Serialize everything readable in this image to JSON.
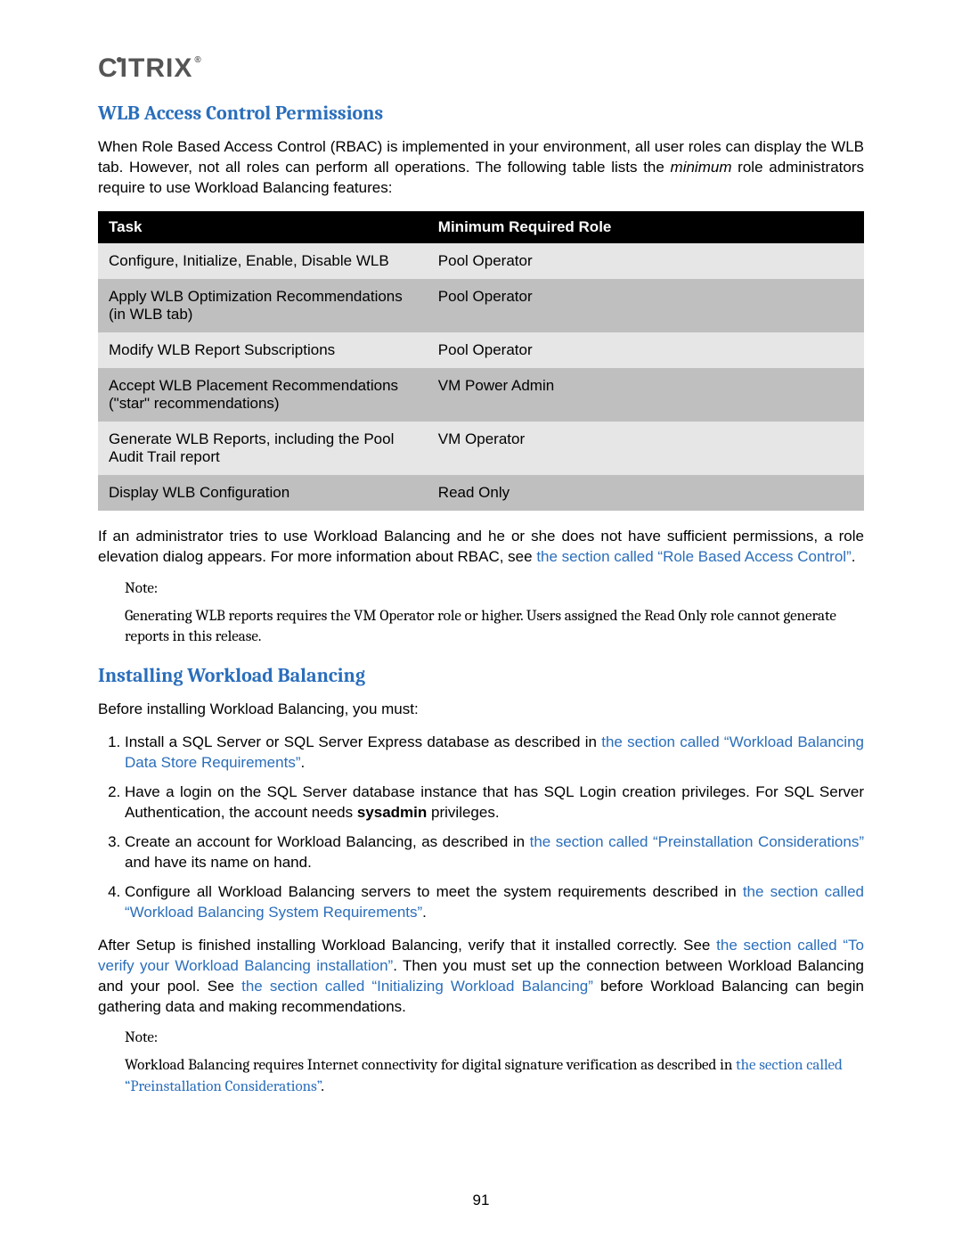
{
  "logo": "CITRIX",
  "sections": {
    "wlb_heading": "WLB Access Control Permissions",
    "wlb_intro_pre": "When Role Based Access Control (RBAC) is implemented in your environment, all user roles can display the WLB tab. However, not all roles can perform all operations. The following table lists the ",
    "wlb_intro_min": "minimum",
    "wlb_intro_post": " role administrators require to use Workload Balancing features:",
    "table": {
      "headers": {
        "task": "Task",
        "role": "Minimum Required Role"
      },
      "rows": [
        {
          "task": "Configure, Initialize, Enable, Disable WLB",
          "role": "Pool Operator"
        },
        {
          "task": "Apply WLB Optimization Recommendations (in WLB tab)",
          "role": "Pool Operator"
        },
        {
          "task": "Modify WLB Report Subscriptions",
          "role": "Pool Operator"
        },
        {
          "task": "Accept WLB Placement Recommendations (\"star\" recommendations)",
          "role": "VM Power Admin"
        },
        {
          "task": "Generate WLB Reports, including the Pool Audit Trail report",
          "role": "VM Operator"
        },
        {
          "task": "Display WLB Configuration",
          "role": "Read Only"
        }
      ]
    },
    "after_table_pre": "If an administrator tries to use Workload Balancing and he or she does not have sufficient permissions, a role elevation dialog appears. For more information about RBAC, see ",
    "after_table_link": "the section called “Role Based Access Control”",
    "after_table_post": ".",
    "note1_label": "Note:",
    "note1_body": "Generating WLB reports requires the VM Operator role or higher. Users assigned the Read Only role cannot generate reports in this release.",
    "install_heading": "Installing Workload Balancing",
    "install_intro": "Before installing Workload Balancing, you must:",
    "steps": {
      "s1_pre": "Install a SQL Server or SQL Server Express database as described in ",
      "s1_link": "the section called “Workload Balancing Data Store Requirements”",
      "s1_post": ".",
      "s2_pre": "Have a login on the SQL Server database instance that has SQL Login creation privileges. For SQL Server Authentication, the account needs ",
      "s2_bold": "sysadmin",
      "s2_post": " privileges.",
      "s3_pre": "Create an account for Workload Balancing, as described in ",
      "s3_link": "the section called “Preinstallation Considerations”",
      "s3_post": " and have its name on hand.",
      "s4_pre": "Configure all Workload Balancing servers to meet the system requirements described in ",
      "s4_link": "the section called “Workload Balancing System Requirements”",
      "s4_post": "."
    },
    "after_steps_1": "After Setup is finished installing Workload Balancing, verify that it installed correctly. See ",
    "after_steps_link1": "the section called “To verify your Workload Balancing installation”",
    "after_steps_2": ". Then you must set up the connection between Workload Balancing and your pool. See ",
    "after_steps_link2": "the section called “Initializing Workload Balancing”",
    "after_steps_3": " before Workload Balancing can begin gathering data and making recommendations.",
    "note2_label": "Note:",
    "note2_body_pre": "Workload Balancing requires Internet connectivity for digital signature verification as described in ",
    "note2_body_link": "the section called “Preinstallation Considerations”",
    "note2_body_post": "."
  },
  "page_number": "91"
}
